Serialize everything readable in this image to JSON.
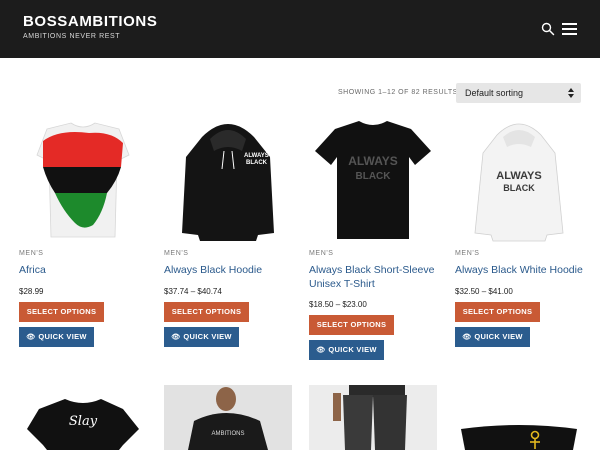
{
  "header": {
    "site_title": "BOSSAMBITIONS",
    "tagline": "AMBITIONS NEVER REST",
    "search_icon": "search-icon",
    "menu_icon": "hamburger-menu-icon"
  },
  "toolbar": {
    "result_count": "SHOWING 1–12 OF 82 RESULTS",
    "sort_value": "Default sorting"
  },
  "products": [
    {
      "category": "MEN'S",
      "title": "Africa",
      "price": "$28.99",
      "select_label": "SELECT OPTIONS",
      "quick_label": "QUICK VIEW"
    },
    {
      "category": "MEN'S",
      "title": "Always Black Hoodie",
      "price": "$37.74 – $40.74",
      "select_label": "SELECT OPTIONS",
      "quick_label": "QUICK VIEW"
    },
    {
      "category": "MEN'S",
      "title": "Always Black Short-Sleeve Unisex T-Shirt",
      "price": "$18.50 – $23.00",
      "select_label": "SELECT OPTIONS",
      "quick_label": "QUICK VIEW"
    },
    {
      "category": "MEN'S",
      "title": "Always Black White Hoodie",
      "price": "$32.50 – $41.00",
      "select_label": "SELECT OPTIONS",
      "quick_label": "QUICK VIEW"
    }
  ],
  "colors": {
    "header_bg": "#1c1c1c",
    "select_button": "#c95a35",
    "quick_view_button": "#2b5c8e",
    "product_title": "#2b5a8c"
  }
}
